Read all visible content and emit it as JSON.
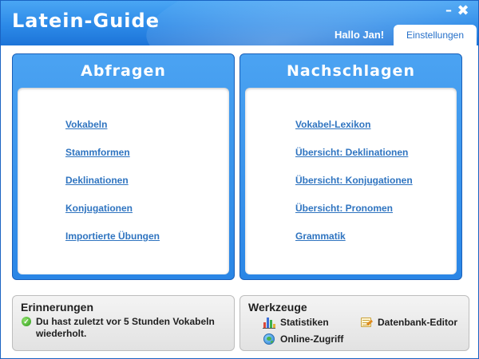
{
  "app": {
    "title": "Latein-Guide",
    "greeting": "Hallo Jan!",
    "settings_tab": "Einstellungen",
    "minimize_label": "–",
    "close_label": "✖"
  },
  "colors": {
    "brand_blue": "#2c8ae8",
    "link_blue": "#2f74c0"
  },
  "abfragen": {
    "title": "Abfragen",
    "links": [
      "Vokabeln",
      "Stammformen",
      "Deklinationen",
      "Konjugationen",
      "Importierte Übungen"
    ]
  },
  "nachschlagen": {
    "title": "Nachschlagen",
    "links": [
      "Vokabel-Lexikon",
      "Übersicht: Deklinationen",
      "Übersicht: Konjugationen",
      "Übersicht: Pronomen",
      "Grammatik"
    ]
  },
  "erinnerungen": {
    "title": "Erinnerungen",
    "icon": "check-circle-icon",
    "text": "Du hast zuletzt vor 5 Stunden Vokabeln wiederholt."
  },
  "werkzeuge": {
    "title": "Werkzeuge",
    "tools": [
      {
        "label": "Statistiken",
        "icon": "bar-chart-icon"
      },
      {
        "label": "Datenbank-Editor",
        "icon": "database-editor-icon"
      },
      {
        "label": "Online-Zugriff",
        "icon": "globe-icon"
      }
    ]
  }
}
